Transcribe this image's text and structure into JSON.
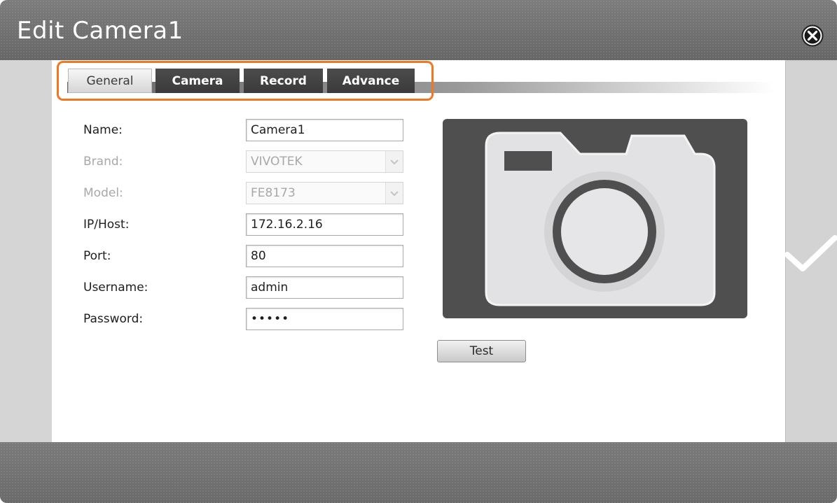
{
  "window": {
    "title": "Edit Camera1"
  },
  "tabs": [
    {
      "label": "General",
      "active": true
    },
    {
      "label": "Camera",
      "active": false
    },
    {
      "label": "Record",
      "active": false
    },
    {
      "label": "Advance",
      "active": false
    }
  ],
  "form": {
    "name": {
      "label": "Name:",
      "value": "Camera1"
    },
    "brand": {
      "label": "Brand:",
      "value": "VIVOTEK"
    },
    "model": {
      "label": "Model:",
      "value": "FE8173"
    },
    "ip": {
      "label": "IP/Host:",
      "value": "172.16.2.16"
    },
    "port": {
      "label": "Port:",
      "value": "80"
    },
    "username": {
      "label": "Username:",
      "value": "admin"
    },
    "password": {
      "label": "Password:",
      "value": "•••••"
    }
  },
  "preview": {
    "icon": "camera-icon"
  },
  "buttons": {
    "test_label": "Test"
  },
  "colors": {
    "highlight": "#f07822",
    "tab_inactive": "#3f3f3f",
    "preview_bg": "#4f4f4f",
    "titlebar": "#707070"
  },
  "icons": {
    "close": "close-icon",
    "confirm": "checkmark-icon"
  }
}
